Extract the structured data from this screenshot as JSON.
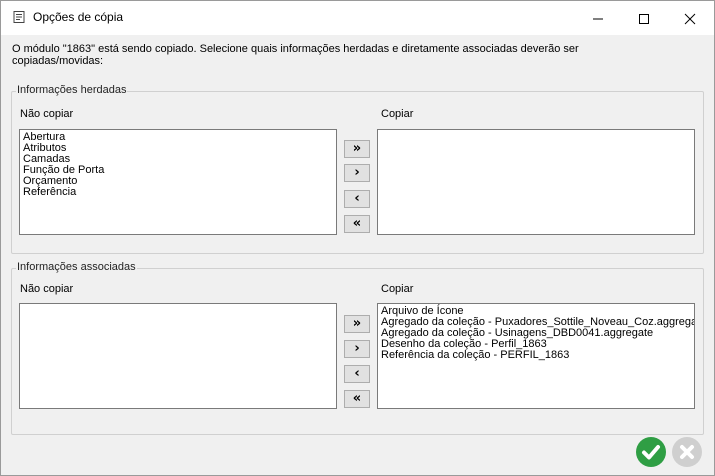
{
  "window": {
    "title": "Opções de cópia"
  },
  "description": "O módulo \"1863\" está sendo copiado. Selecione quais informações herdadas e diretamente associadas deverão ser copiadas/movidas:",
  "inherited": {
    "title": "Informações herdadas",
    "no_copy_label": "Não copiar",
    "copy_label": "Copiar",
    "no_copy_items": [
      "Abertura",
      "Atributos",
      "Camadas",
      "Função de Porta",
      "Orçamento",
      "Referência"
    ],
    "copy_items": []
  },
  "associated": {
    "title": "Informações associadas",
    "no_copy_label": "Não copiar",
    "copy_label": "Copiar",
    "no_copy_items": [],
    "copy_items": [
      "Arquivo de Ícone",
      "Agregado da coleção - Puxadores_Sottile_Noveau_Coz.aggregate",
      "Agregado da coleção - Usinagens_DBD0041.aggregate",
      "Desenho da coleção - Perfil_1863",
      "Referência da coleção - PERFIL_1863"
    ]
  },
  "buttons": {
    "move_all_right": "»",
    "move_right": "›",
    "move_left": "‹",
    "move_all_left": "«"
  },
  "colors": {
    "ok": "#2f9e44",
    "cancel": "#cfcfcf"
  },
  "icons": {
    "ok": "check-circle-icon",
    "cancel": "x-circle-icon"
  }
}
